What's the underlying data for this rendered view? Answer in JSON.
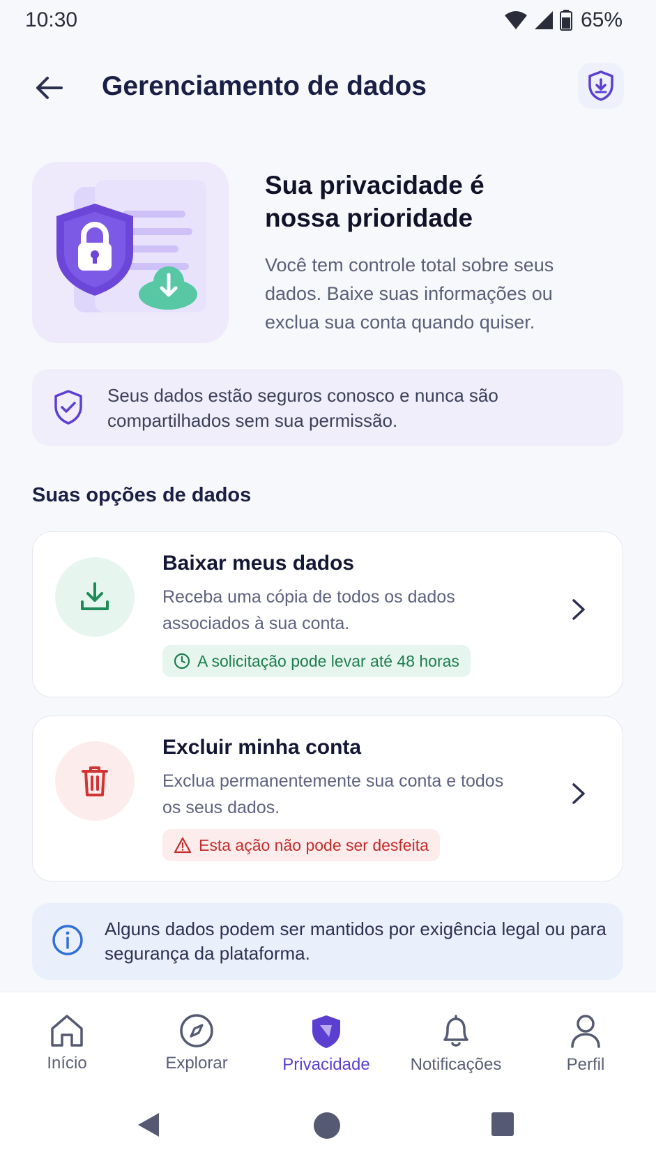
{
  "status_bar": {
    "time": "10:30",
    "battery": "65%"
  },
  "app_bar": {
    "title": "Gerenciamento de dados"
  },
  "hero": {
    "title_line1": "Sua privacidade é",
    "title_line2": "nossa prioridade",
    "text": "Você tem controle total sobre seus dados. Baixe suas informações ou exclua sua conta quando quiser."
  },
  "secure_banner": {
    "text": "Seus dados estão seguros conosco e nunca são compartilhados sem sua permissão."
  },
  "section": {
    "heading": "Suas opções de dados"
  },
  "options": [
    {
      "title": "Baixar meus dados",
      "description": "Receba uma cópia de todos os dados associados à sua conta.",
      "badge": "A solicitação pode levar até 48 horas",
      "icon": "download-icon"
    },
    {
      "title": "Excluir minha conta",
      "description": "Exclua permanentemente sua conta e todos os seus dados.",
      "badge": "Esta ação não pode ser desfeita",
      "icon": "trash-icon"
    }
  ],
  "info_banner": {
    "text": "Alguns dados podem ser mantidos por exigência legal ou para segurança da plataforma."
  },
  "bottom_nav": [
    {
      "label": "Início",
      "icon": "home-icon"
    },
    {
      "label": "Explorar",
      "icon": "compass-icon"
    },
    {
      "label": "Privacidade",
      "icon": "shield-icon",
      "active": true
    },
    {
      "label": "Notificações",
      "icon": "bell-icon"
    },
    {
      "label": "Perfil",
      "icon": "user-icon"
    }
  ],
  "colors": {
    "accent": "#5b3fd1",
    "success": "#1e7d4c",
    "danger": "#c42b2b",
    "info": "#2f6fd6"
  }
}
